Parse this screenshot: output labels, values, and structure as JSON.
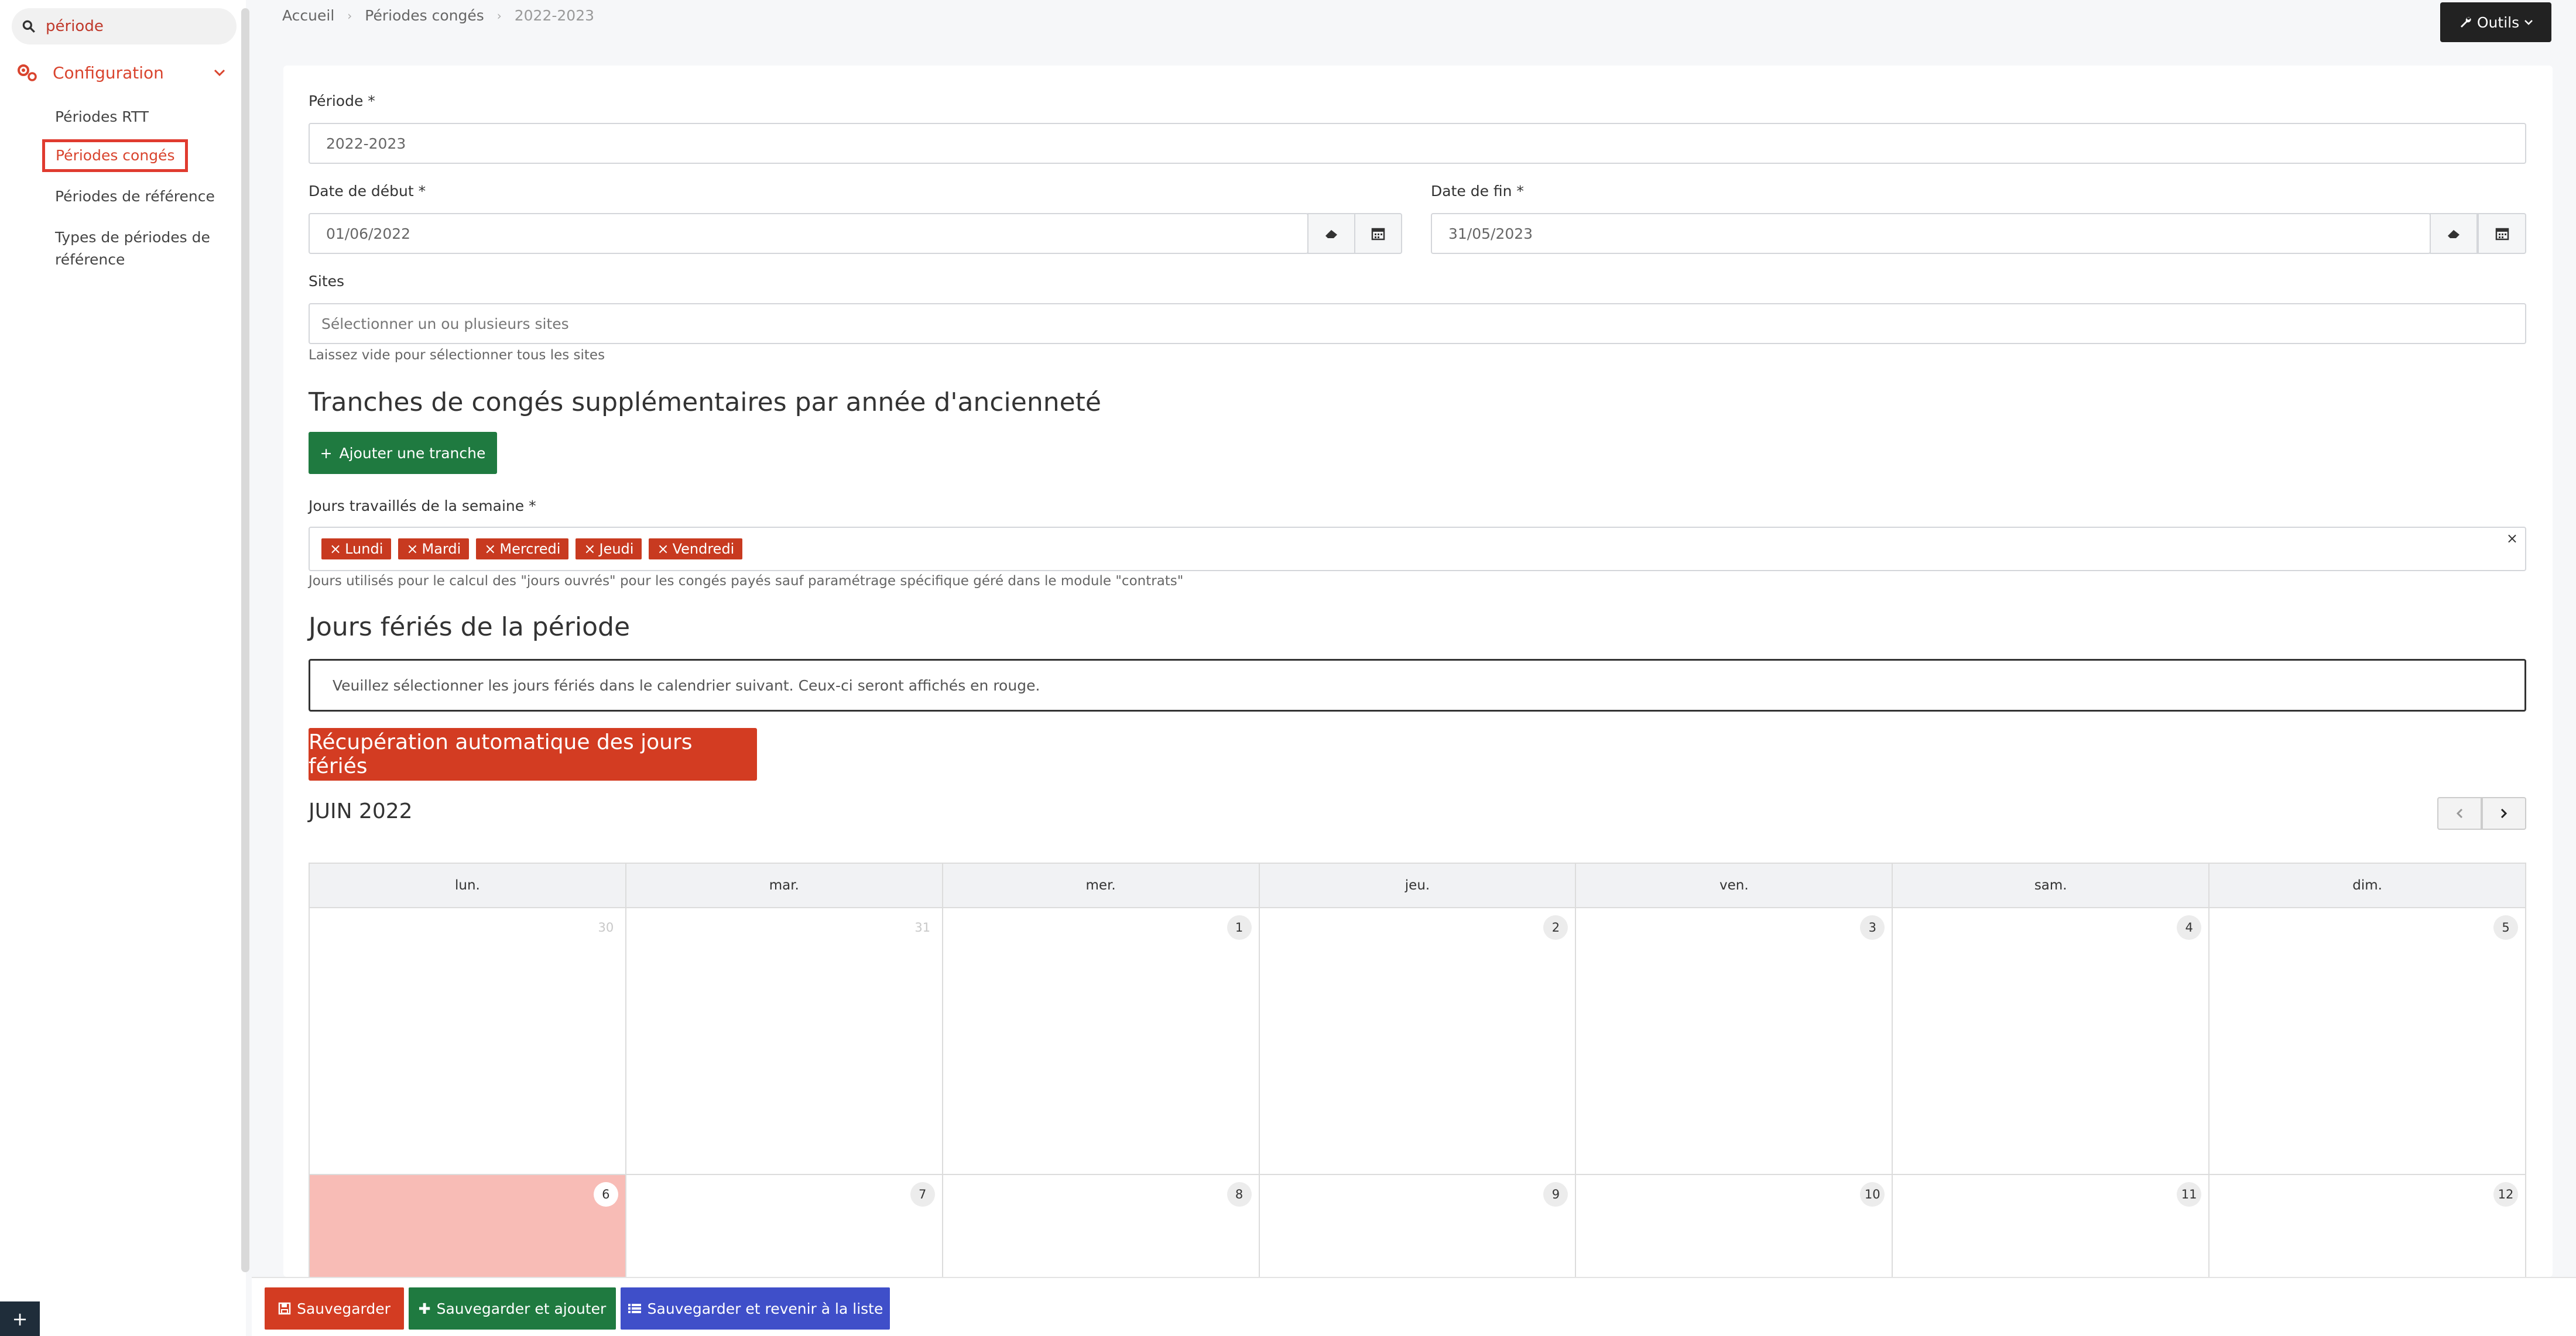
{
  "sidebar": {
    "search": {
      "value": "période"
    },
    "config_label": "Configuration",
    "items": [
      {
        "label": "Périodes RTT"
      },
      {
        "label": "Périodes congés"
      },
      {
        "label": "Périodes de référence"
      },
      {
        "label": "Types de périodes de",
        "label2": "référence"
      }
    ],
    "bottom_button": "+"
  },
  "breadcrumb": {
    "home": "Accueil",
    "section": "Périodes congés",
    "current": "2022-2023"
  },
  "toolbar": {
    "tools_label": "Outils"
  },
  "form": {
    "periode_label": "Période *",
    "periode_value": "2022-2023",
    "date_debut_label": "Date de début *",
    "date_debut_value": "01/06/2022",
    "date_fin_label": "Date de fin *",
    "date_fin_value": "31/05/2023",
    "sites_label": "Sites",
    "sites_placeholder": "Sélectionner un ou plusieurs sites",
    "sites_help": "Laissez vide pour sélectionner tous les sites",
    "tranches_title": "Tranches de congés supplémentaires par année d'ancienneté",
    "add_tranche_label": "Ajouter une tranche",
    "jours_label": "Jours travaillés de la semaine *",
    "jours_tags": [
      "Lundi",
      "Mardi",
      "Mercredi",
      "Jeudi",
      "Vendredi"
    ],
    "jours_help": "Jours utilisés pour le calcul des \"jours ouvrés\" pour les congés payés sauf paramétrage spécifique géré dans le module \"contrats\"",
    "feries_title": "Jours fériés de la période",
    "feries_notice": "Veuillez sélectionner les jours fériés dans le calendrier suivant. Ceux-ci seront affichés en rouge.",
    "auto_recup_label": "Récupération automatique des jours fériés"
  },
  "calendar": {
    "month_title": "JUIN 2022",
    "weekdays": [
      "lun.",
      "mar.",
      "mer.",
      "jeu.",
      "ven.",
      "sam.",
      "dim."
    ],
    "week1": [
      "30",
      "31",
      "1",
      "2",
      "3",
      "4",
      "5"
    ],
    "week2": [
      "6",
      "7",
      "8",
      "9",
      "10",
      "11",
      "12"
    ],
    "holiday_color": "#f8bcb6"
  },
  "footer": {
    "save_label": "Sauvegarder",
    "save_add_label": "Sauvegarder et ajouter",
    "save_list_label": "Sauvegarder et revenir à la liste"
  },
  "colors": {
    "accent_red": "#d33c22",
    "green": "#1f7a40",
    "blue": "#3f4fc9"
  }
}
